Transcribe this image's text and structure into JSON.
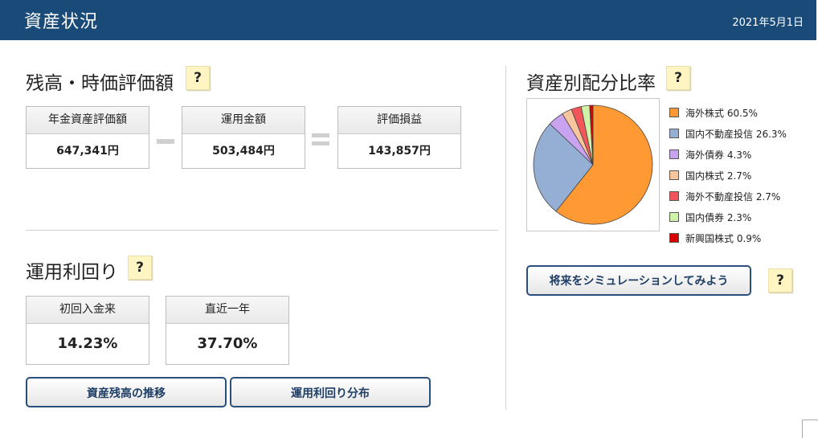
{
  "header": {
    "title": "資産状況",
    "date": "2021年5月1日"
  },
  "valuation": {
    "title": "残高・時価評価額",
    "help": "?",
    "boxes": [
      {
        "label": "年金資産評価額",
        "value": "647,341円"
      },
      {
        "label": "運用金額",
        "value": "503,484円"
      },
      {
        "label": "評価損益",
        "value": "143,857円"
      }
    ]
  },
  "yield": {
    "title": "運用利回り",
    "help": "?",
    "boxes": [
      {
        "label": "初回入金来",
        "value": "14.23%"
      },
      {
        "label": "直近一年",
        "value": "37.70%"
      }
    ]
  },
  "buttons": {
    "balance_history": "資産残高の推移",
    "yield_distribution": "運用利回り分布",
    "simulation": "将来をシミュレーションしてみよう"
  },
  "allocation": {
    "title": "資産別配分比率",
    "help": "?",
    "simulation_help": "?",
    "items": [
      {
        "label": "海外株式 60.5%",
        "value": 60.5,
        "color": "#ff9933"
      },
      {
        "label": "国内不動産投信 26.3%",
        "value": 26.3,
        "color": "#94afd3"
      },
      {
        "label": "海外債券 4.3%",
        "value": 4.3,
        "color": "#c9a3f0"
      },
      {
        "label": "国内株式 2.7%",
        "value": 2.7,
        "color": "#f8c59c"
      },
      {
        "label": "海外不動産投信 2.7%",
        "value": 2.7,
        "color": "#f2565a"
      },
      {
        "label": "国内債券 2.3%",
        "value": 2.3,
        "color": "#cdf2a8"
      },
      {
        "label": "新興国株式 0.9%",
        "value": 0.9,
        "color": "#d90000"
      }
    ]
  }
}
